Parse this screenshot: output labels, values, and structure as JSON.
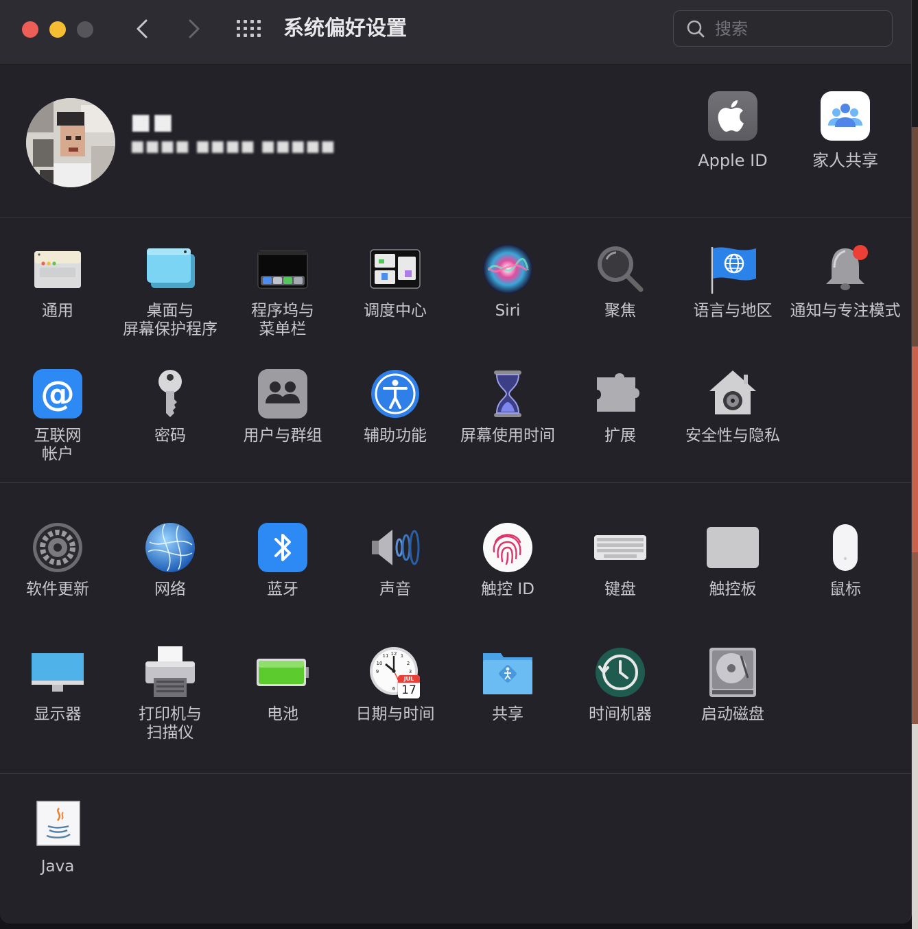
{
  "window": {
    "title": "系统偏好设置",
    "search_placeholder": "搜索"
  },
  "user": {
    "name": "■■",
    "email": "■■■■ ■■■■ ■■■■■"
  },
  "top_items": [
    {
      "label": "Apple ID",
      "icon": "apple-id-icon"
    },
    {
      "label": "家人共享",
      "icon": "family-sharing-icon"
    }
  ],
  "section1": [
    {
      "label": "通用",
      "icon": "general-icon"
    },
    {
      "label": "桌面与\n屏幕保护程序",
      "icon": "desktop-screensaver-icon"
    },
    {
      "label": "程序坞与\n菜单栏",
      "icon": "dock-menubar-icon"
    },
    {
      "label": "调度中心",
      "icon": "mission-control-icon"
    },
    {
      "label": "Siri",
      "icon": "siri-icon"
    },
    {
      "label": "聚焦",
      "icon": "spotlight-icon"
    },
    {
      "label": "语言与地区",
      "icon": "language-region-icon"
    },
    {
      "label": "通知与专注模式",
      "icon": "notifications-icon"
    },
    {
      "label": "互联网\n帐户",
      "icon": "internet-accounts-icon"
    },
    {
      "label": "密码",
      "icon": "passwords-icon"
    },
    {
      "label": "用户与群组",
      "icon": "users-groups-icon"
    },
    {
      "label": "辅助功能",
      "icon": "accessibility-icon"
    },
    {
      "label": "屏幕使用时间",
      "icon": "screen-time-icon"
    },
    {
      "label": "扩展",
      "icon": "extensions-icon"
    },
    {
      "label": "安全性与隐私",
      "icon": "security-privacy-icon"
    }
  ],
  "section2": [
    {
      "label": "软件更新",
      "icon": "software-update-icon"
    },
    {
      "label": "网络",
      "icon": "network-icon"
    },
    {
      "label": "蓝牙",
      "icon": "bluetooth-icon"
    },
    {
      "label": "声音",
      "icon": "sound-icon"
    },
    {
      "label": "触控 ID",
      "icon": "touch-id-icon"
    },
    {
      "label": "键盘",
      "icon": "keyboard-icon"
    },
    {
      "label": "触控板",
      "icon": "trackpad-icon"
    },
    {
      "label": "鼠标",
      "icon": "mouse-icon"
    },
    {
      "label": "显示器",
      "icon": "displays-icon"
    },
    {
      "label": "打印机与\n扫描仪",
      "icon": "printers-scanners-icon"
    },
    {
      "label": "电池",
      "icon": "battery-icon"
    },
    {
      "label": "日期与时间",
      "icon": "date-time-icon"
    },
    {
      "label": "共享",
      "icon": "sharing-icon"
    },
    {
      "label": "时间机器",
      "icon": "time-machine-icon"
    },
    {
      "label": "启动磁盘",
      "icon": "startup-disk-icon"
    }
  ],
  "section3": [
    {
      "label": "Java",
      "icon": "java-icon"
    }
  ],
  "calendar": {
    "month": "JUL",
    "day": "17"
  }
}
